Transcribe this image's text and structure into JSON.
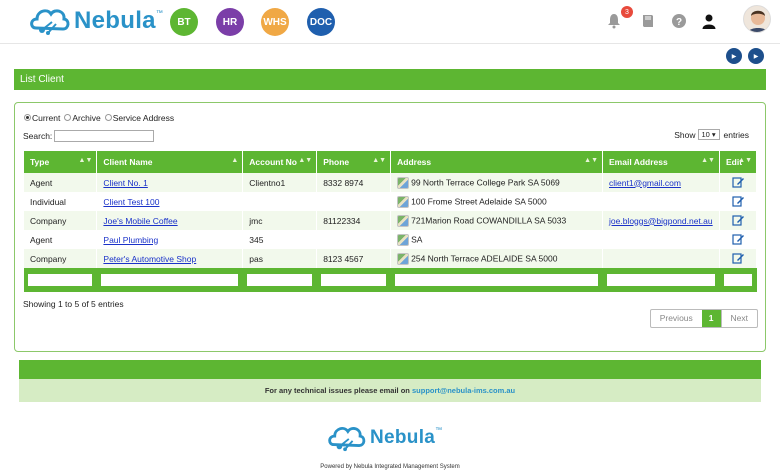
{
  "header": {
    "brand": "Nebula",
    "brand_tm": "™",
    "modules": [
      {
        "label": "BT",
        "color": "#5db632"
      },
      {
        "label": "HR",
        "color": "#7b3ea8"
      },
      {
        "label": "WHS",
        "color": "#f0a845"
      },
      {
        "label": "DOC",
        "color": "#1f5fae"
      }
    ],
    "notification_count": "3",
    "help_icons": [
      "Video help",
      "Video"
    ]
  },
  "page_title": "List Client",
  "filters": {
    "options": [
      "Current",
      "Archive",
      "Service Address"
    ],
    "selected": "Current",
    "search_label": "Search:",
    "search_value": "",
    "show_label": "Show",
    "show_value": "10",
    "entries_label": "entries"
  },
  "table": {
    "columns": [
      "Type",
      "Client Name",
      "Account No",
      "Phone",
      "Address",
      "Email Address",
      "Edit"
    ],
    "rows": [
      {
        "type": "Agent",
        "name": "Client No. 1",
        "account": "Clientno1",
        "phone": "8332 8974",
        "address": "99 North Terrace College Park SA 5069",
        "email": "client1@gmail.com"
      },
      {
        "type": "Individual",
        "name": "Client Test 100",
        "account": "",
        "phone": "",
        "address": "100 Frome Street Adelaide SA 5000",
        "email": ""
      },
      {
        "type": "Company",
        "name": "Joe's Mobile Coffee",
        "account": "jmc",
        "phone": "81122334",
        "address": "721Marion Road COWANDILLA SA 5033",
        "email": "joe.bloggs@bigpond.net.au"
      },
      {
        "type": "Agent",
        "name": "Paul Plumbing",
        "account": "345",
        "phone": "",
        "address": "SA",
        "email": ""
      },
      {
        "type": "Company",
        "name": "Peter's Automotive Shop",
        "account": "pas",
        "phone": "8123 4567",
        "address": "254 North Terrace ADELAIDE SA 5000",
        "email": ""
      }
    ]
  },
  "pagination": {
    "summary": "Showing 1 to 5 of 5 entries",
    "previous": "Previous",
    "current": "1",
    "next": "Next"
  },
  "footer": {
    "support_text": "For any technical issues please email on",
    "support_email": "support@nebula-ims.com.au",
    "brand": "Nebula",
    "powered_by": "Powered by Nebula Integrated Management System"
  }
}
